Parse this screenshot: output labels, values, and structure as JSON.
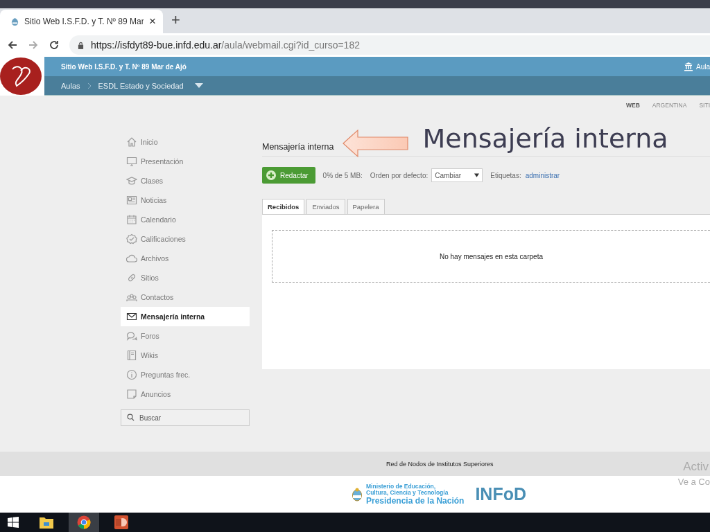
{
  "browser": {
    "tab_title": "Sitio Web I.S.F.D. y T. Nº 89 Mar",
    "tab_close": "×",
    "new_tab": "+",
    "url_host": "https://isfdyt89-bue.infd.edu.ar",
    "url_path": "/aula/webmail.cgi?id_curso=182"
  },
  "header": {
    "site_title": "Sitio Web I.S.F.D. y T. Nº 89 Mar de Ajó",
    "aulas_link": "Aula",
    "breadcrumb": [
      "Aulas",
      "ESDL Estado y Sociedad"
    ]
  },
  "top_links": [
    "WEB",
    "ARGENTINA",
    "SITI"
  ],
  "sidebar": {
    "items": [
      {
        "label": "Inicio",
        "selected": false
      },
      {
        "label": "Presentación",
        "selected": false
      },
      {
        "label": "Clases",
        "selected": false
      },
      {
        "label": "Noticias",
        "selected": false
      },
      {
        "label": "Calendario",
        "selected": false
      },
      {
        "label": "Calificaciones",
        "selected": false
      },
      {
        "label": "Archivos",
        "selected": false
      },
      {
        "label": "Sitios",
        "selected": false
      },
      {
        "label": "Contactos",
        "selected": false
      },
      {
        "label": "Mensajería interna",
        "selected": true
      },
      {
        "label": "Foros",
        "selected": false
      },
      {
        "label": "Wikis",
        "selected": false
      },
      {
        "label": "Preguntas frec.",
        "selected": false
      },
      {
        "label": "Anuncios",
        "selected": false
      }
    ],
    "search": {
      "placeholder": "Buscar"
    }
  },
  "main": {
    "title": "Mensajería interna",
    "annotation": "Mensajería interna",
    "compose": "Redactar",
    "quota": "0% de 5 MB:",
    "sort_label": "Orden por defecto:",
    "sort_value": "Cambiar",
    "tags_label": "Etiquetas:",
    "tags_link": "administrar",
    "tabs": [
      {
        "label": "Recibidos",
        "selected": true
      },
      {
        "label": "Enviados",
        "selected": false
      },
      {
        "label": "Papelera",
        "selected": false
      }
    ],
    "empty": "No hay mensajes en esta carpeta"
  },
  "footer": {
    "network": "Red de Nodos de Institutos Superiores",
    "ministry": [
      "Ministerio de Educación,",
      "Cultura, Ciencia y Tecnología"
    ],
    "presidency": "Presidencia de la Nación",
    "infod": "INFoD"
  },
  "activation": [
    "Activ",
    "Ve a Co"
  ]
}
